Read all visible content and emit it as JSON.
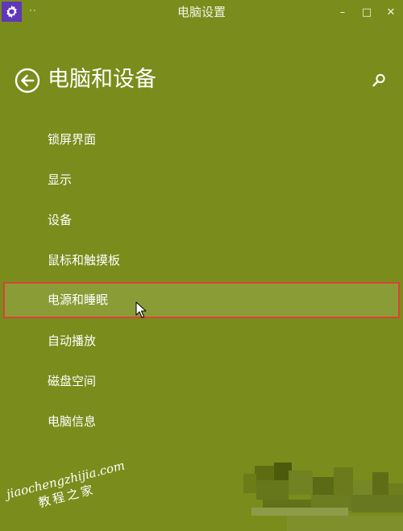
{
  "window": {
    "title": "电脑设置",
    "menu_dots": "··",
    "minimize": "–",
    "maximize": "□",
    "close": "✕"
  },
  "header": {
    "title": "电脑和设备"
  },
  "menu": {
    "items": [
      {
        "label": "锁屏界面"
      },
      {
        "label": "显示"
      },
      {
        "label": "设备"
      },
      {
        "label": "鼠标和触摸板"
      },
      {
        "label": "电源和睡眠",
        "selected": true
      },
      {
        "label": "自动播放"
      },
      {
        "label": "磁盘空间"
      },
      {
        "label": "电脑信息"
      }
    ]
  },
  "watermark": {
    "domain": "jiaochengzhijia.com",
    "chinese": "教程之家"
  },
  "icons": {
    "app": "gear-icon",
    "back": "back-arrow-icon",
    "search": "search-icon",
    "cursor": "mouse-pointer-icon"
  },
  "colors": {
    "background": "#7a8c1b",
    "selected_row": "#8a9c36",
    "highlight_border": "#d8433a",
    "app_icon_bg": "#5f37b9"
  }
}
